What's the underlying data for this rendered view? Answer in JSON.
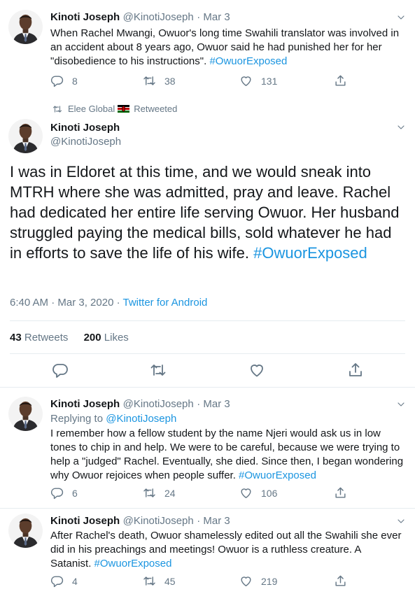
{
  "tweets": [
    {
      "name": "Kinoti Joseph",
      "handle": "@KinotiJoseph",
      "date": "Mar 3",
      "text": "When Rachel Mwangi, Owuor's long time Swahili translator was involved in an accident about 8 years ago, Owuor said he had punished her for her \"disobedience to his instructions\".",
      "hashtag": "#OwuorExposed",
      "replies": "8",
      "retweets": "38",
      "likes": "131"
    },
    {
      "name": "Kinoti Joseph",
      "handle": "@KinotiJoseph",
      "date": "Mar 3",
      "replying_label": "Replying to",
      "replying_to": "@KinotiJoseph",
      "text": "I remember how a fellow student by the name Njeri would ask us in low tones to chip in and help. We were to be careful, because we were trying to help a \"judged\" Rachel. Eventually, she died. Since then, I began wondering why Owuor rejoices when people suffer.",
      "hashtag": "#OwuorExposed",
      "replies": "6",
      "retweets": "24",
      "likes": "106"
    },
    {
      "name": "Kinoti Joseph",
      "handle": "@KinotiJoseph",
      "date": "Mar 3",
      "text": "After Rachel's death, Owuor shamelessly edited out all the Swahili she ever did in his preachings and meetings! Owuor is a ruthless creature. A Satanist.",
      "hashtag": "#OwuorExposed",
      "replies": "4",
      "retweets": "45",
      "likes": "219"
    }
  ],
  "main_tweet": {
    "retweeted_by": "Elee Global",
    "retweeted_label": "Retweeted",
    "name": "Kinoti Joseph",
    "handle": "@KinotiJoseph",
    "text": "I was in Eldoret at this time, and we would sneak into MTRH where she was admitted, pray and leave. Rachel had dedicated her entire life serving Owuor. Her husband struggled paying the medical bills, sold whatever he had in efforts to save the life of his wife.",
    "hashtag": "#OwuorExposed",
    "time": "6:40 AM · Mar 3, 2020 · ",
    "source": "Twitter for Android",
    "retweet_count": "43",
    "retweet_label": "Retweets",
    "like_count": "200",
    "like_label": "Likes"
  },
  "colors": {
    "text": "#14171a",
    "secondary": "#657786",
    "link": "#1b95e0",
    "border": "#e6ecf0"
  },
  "icons": [
    "reply-icon",
    "retweet-icon",
    "like-icon",
    "share-icon",
    "chevron-down-icon",
    "kenya-flag-icon"
  ]
}
